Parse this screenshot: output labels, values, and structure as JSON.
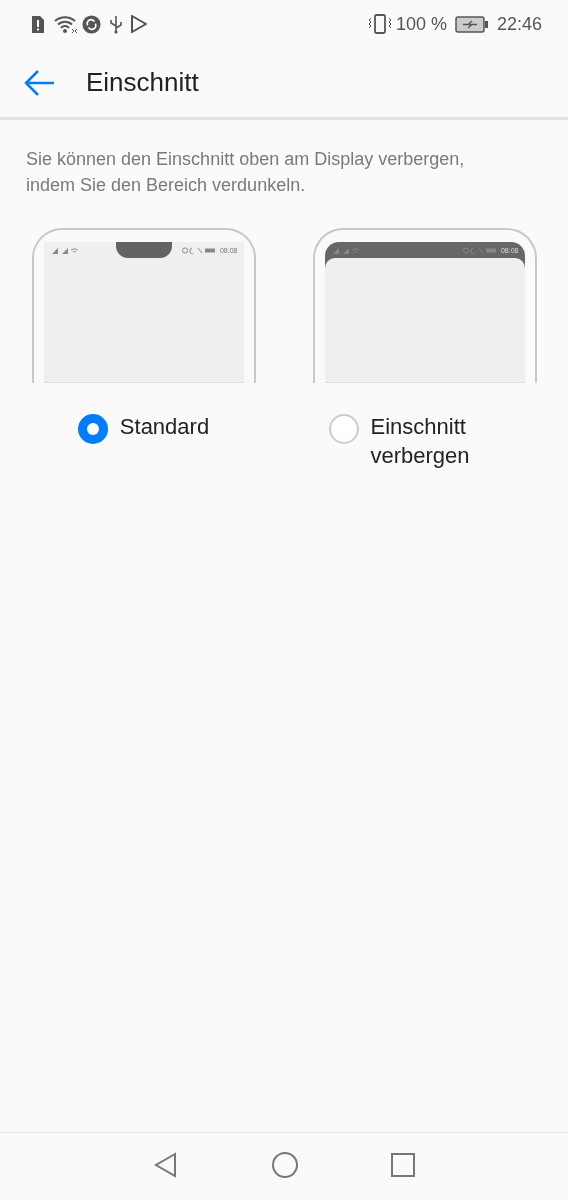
{
  "status_bar": {
    "battery_percent": "100 %",
    "time": "22:46"
  },
  "header": {
    "title": "Einschnitt"
  },
  "description": "Sie können den Einschnitt oben am Display verbergen, indem Sie den Bereich verdunkeln.",
  "options": [
    {
      "kind": "notch",
      "label": "Standard",
      "selected": true,
      "preview_time": "08:08"
    },
    {
      "kind": "hidden",
      "label": "Einschnitt verbergen",
      "selected": false,
      "preview_time": "08:08"
    }
  ]
}
